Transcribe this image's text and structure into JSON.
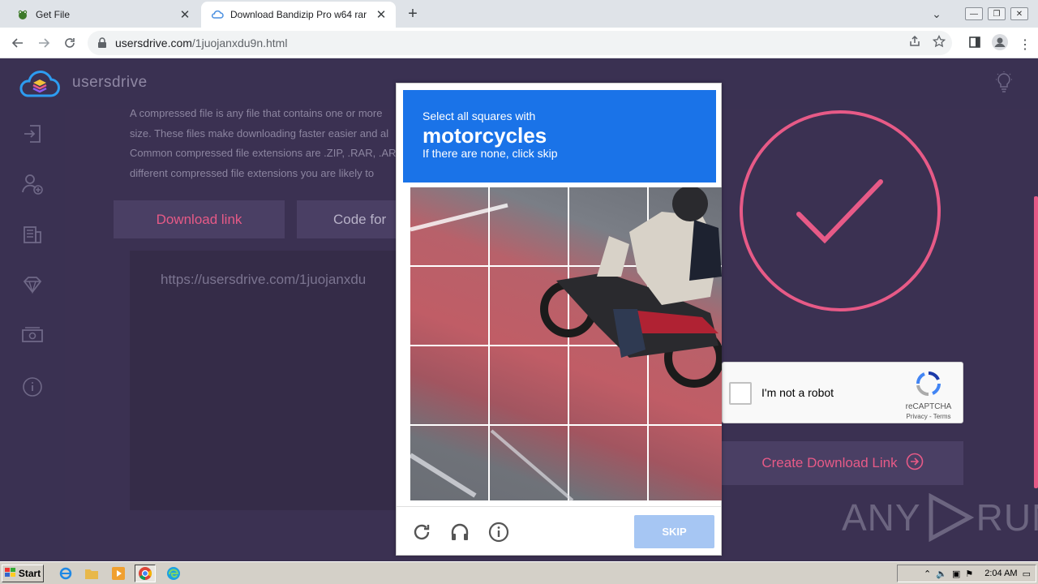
{
  "browser": {
    "tabs": [
      {
        "title": "Get File",
        "active": false
      },
      {
        "title": "Download Bandizip Pro w64 rar",
        "active": true
      }
    ],
    "address": {
      "domain": "usersdrive.com",
      "path": "/1juojanxdu9n.html"
    }
  },
  "site": {
    "name": "usersdrive",
    "description_lines": [
      "A compressed file is any file that contains one or more",
      "size. These files make downloading faster easier and al",
      "Common compressed file extensions are .ZIP, .RAR, .AR",
      "different compressed file extensions you are likely to"
    ],
    "download_link_label": "Download link",
    "code_for_label": "Code for",
    "link_text": "https://usersdrive.com/1juojanxdu",
    "create_button_label": "Create Download Link",
    "accent_color": "#e75a87"
  },
  "recaptcha": {
    "anchor_label": "I'm not a robot",
    "brand": "reCAPTCHA",
    "legal": "Privacy - Terms",
    "challenge": {
      "line1": "Select all squares with",
      "target": "motorcycles",
      "line3": "If there are none, click skip",
      "skip_label": "SKIP",
      "header_color": "#1a73e8"
    }
  },
  "watermark": {
    "left": "ANY",
    "right": "RUN"
  },
  "taskbar": {
    "start_label": "Start",
    "clock": "2:04 AM"
  }
}
